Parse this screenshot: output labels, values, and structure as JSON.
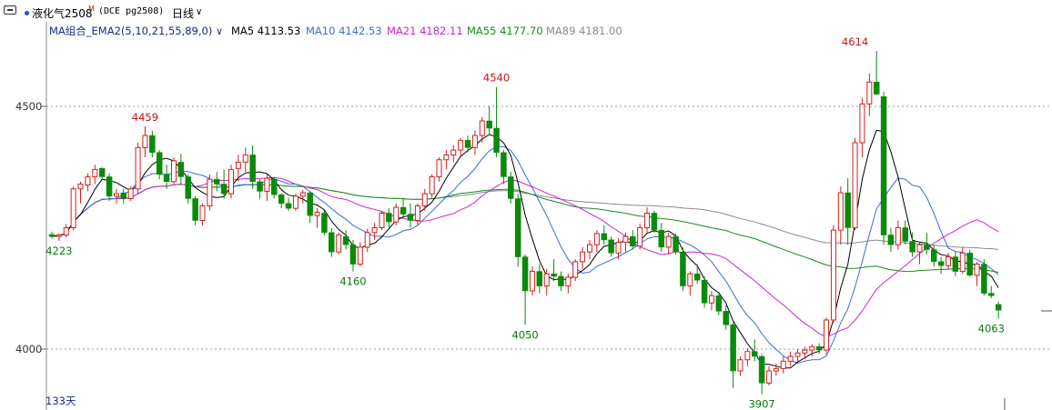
{
  "toolbar": {
    "symbol_name": "液化气2508",
    "superscript": "M",
    "code": "(DCE pg2508)",
    "period": "日线"
  },
  "legend": {
    "group": "MA组合_EMA2(5,10,21,55,89,0)",
    "items": [
      {
        "label": "MA5 4113.53",
        "color": "#000000"
      },
      {
        "label": "MA10 4142.53",
        "color": "#3a6ad8"
      },
      {
        "label": "MA21 4182.11",
        "color": "#d020d0"
      },
      {
        "label": "MA55 4177.70",
        "color": "#1a8a1a"
      },
      {
        "label": "MA89 4181.00",
        "color": "#8a8a8a"
      }
    ]
  },
  "days_label": "133天",
  "chart_data": {
    "type": "candlestick",
    "y_ticks": [
      4000,
      4500
    ],
    "up_color": "#d02020",
    "down_color": "#0a8a0a",
    "annotations": [
      {
        "value": 4223,
        "label": "4223",
        "kind": "low",
        "index": 1
      },
      {
        "value": 4459,
        "label": "4459",
        "kind": "high",
        "index": 13
      },
      {
        "value": 4160,
        "label": "4160",
        "kind": "low",
        "index": 42
      },
      {
        "value": 4540,
        "label": "4540",
        "kind": "high",
        "index": 62
      },
      {
        "value": 4050,
        "label": "4050",
        "kind": "low",
        "index": 66
      },
      {
        "value": 3907,
        "label": "3907",
        "kind": "low",
        "index": 99
      },
      {
        "value": 4614,
        "label": "4614",
        "kind": "high",
        "index": 112
      },
      {
        "value": 4063,
        "label": "4063",
        "kind": "low",
        "index": 131
      }
    ],
    "candles": [
      [
        4236,
        4242,
        4228,
        4232
      ],
      [
        4232,
        4238,
        4223,
        4235
      ],
      [
        4235,
        4258,
        4230,
        4250
      ],
      [
        4250,
        4335,
        4245,
        4330
      ],
      [
        4330,
        4345,
        4300,
        4340
      ],
      [
        4338,
        4362,
        4325,
        4355
      ],
      [
        4355,
        4380,
        4340,
        4370
      ],
      [
        4372,
        4375,
        4350,
        4355
      ],
      [
        4355,
        4362,
        4305,
        4315
      ],
      [
        4315,
        4330,
        4300,
        4320
      ],
      [
        4322,
        4330,
        4300,
        4310
      ],
      [
        4310,
        4335,
        4305,
        4330
      ],
      [
        4330,
        4425,
        4320,
        4415
      ],
      [
        4415,
        4459,
        4395,
        4440
      ],
      [
        4440,
        4450,
        4395,
        4405
      ],
      [
        4405,
        4410,
        4350,
        4360
      ],
      [
        4360,
        4380,
        4330,
        4345
      ],
      [
        4345,
        4395,
        4340,
        4388
      ],
      [
        4385,
        4402,
        4340,
        4355
      ],
      [
        4355,
        4360,
        4300,
        4310
      ],
      [
        4310,
        4315,
        4255,
        4265
      ],
      [
        4265,
        4300,
        4255,
        4295
      ],
      [
        4295,
        4360,
        4285,
        4350
      ],
      [
        4350,
        4365,
        4325,
        4340
      ],
      [
        4340,
        4370,
        4310,
        4320
      ],
      [
        4320,
        4380,
        4310,
        4370
      ],
      [
        4372,
        4400,
        4345,
        4385
      ],
      [
        4385,
        4415,
        4365,
        4400
      ],
      [
        4400,
        4420,
        4330,
        4345
      ],
      [
        4345,
        4350,
        4310,
        4325
      ],
      [
        4325,
        4360,
        4305,
        4352
      ],
      [
        4350,
        4355,
        4310,
        4318
      ],
      [
        4318,
        4320,
        4290,
        4300
      ],
      [
        4300,
        4312,
        4285,
        4290
      ],
      [
        4290,
        4320,
        4285,
        4315
      ],
      [
        4315,
        4328,
        4300,
        4322
      ],
      [
        4322,
        4325,
        4260,
        4275
      ],
      [
        4275,
        4290,
        4250,
        4282
      ],
      [
        4280,
        4285,
        4235,
        4240
      ],
      [
        4240,
        4250,
        4190,
        4200
      ],
      [
        4200,
        4240,
        4195,
        4235
      ],
      [
        4232,
        4245,
        4205,
        4215
      ],
      [
        4215,
        4225,
        4160,
        4175
      ],
      [
        4175,
        4220,
        4170,
        4210
      ],
      [
        4210,
        4248,
        4200,
        4240
      ],
      [
        4240,
        4260,
        4225,
        4250
      ],
      [
        4250,
        4285,
        4245,
        4280
      ],
      [
        4280,
        4290,
        4250,
        4262
      ],
      [
        4262,
        4300,
        4255,
        4292
      ],
      [
        4292,
        4310,
        4270,
        4278
      ],
      [
        4278,
        4300,
        4250,
        4265
      ],
      [
        4265,
        4300,
        4255,
        4295
      ],
      [
        4295,
        4330,
        4285,
        4320
      ],
      [
        4320,
        4360,
        4310,
        4355
      ],
      [
        4355,
        4395,
        4345,
        4390
      ],
      [
        4390,
        4410,
        4370,
        4400
      ],
      [
        4400,
        4420,
        4385,
        4410
      ],
      [
        4410,
        4435,
        4395,
        4430
      ],
      [
        4430,
        4440,
        4405,
        4415
      ],
      [
        4415,
        4450,
        4400,
        4440
      ],
      [
        4440,
        4478,
        4425,
        4470
      ],
      [
        4470,
        4500,
        4440,
        4455
      ],
      [
        4455,
        4540,
        4395,
        4405
      ],
      [
        4405,
        4410,
        4340,
        4355
      ],
      [
        4355,
        4365,
        4300,
        4310
      ],
      [
        4310,
        4320,
        4170,
        4190
      ],
      [
        4190,
        4195,
        4050,
        4120
      ],
      [
        4120,
        4170,
        4110,
        4160
      ],
      [
        4160,
        4175,
        4115,
        4130
      ],
      [
        4130,
        4165,
        4110,
        4155
      ],
      [
        4155,
        4185,
        4140,
        4150
      ],
      [
        4150,
        4160,
        4120,
        4130
      ],
      [
        4130,
        4155,
        4115,
        4148
      ],
      [
        4148,
        4185,
        4140,
        4180
      ],
      [
        4180,
        4210,
        4165,
        4200
      ],
      [
        4200,
        4225,
        4185,
        4215
      ],
      [
        4215,
        4245,
        4200,
        4238
      ],
      [
        4238,
        4255,
        4215,
        4225
      ],
      [
        4225,
        4232,
        4190,
        4198
      ],
      [
        4198,
        4228,
        4185,
        4220
      ],
      [
        4220,
        4240,
        4200,
        4232
      ],
      [
        4232,
        4245,
        4205,
        4212
      ],
      [
        4212,
        4258,
        4205,
        4250
      ],
      [
        4250,
        4292,
        4240,
        4280
      ],
      [
        4280,
        4285,
        4240,
        4245
      ],
      [
        4245,
        4260,
        4200,
        4210
      ],
      [
        4210,
        4240,
        4195,
        4232
      ],
      [
        4232,
        4238,
        4195,
        4200
      ],
      [
        4200,
        4210,
        4120,
        4130
      ],
      [
        4130,
        4160,
        4110,
        4155
      ],
      [
        4155,
        4175,
        4135,
        4142
      ],
      [
        4142,
        4150,
        4085,
        4095
      ],
      [
        4095,
        4120,
        4080,
        4110
      ],
      [
        4110,
        4118,
        4070,
        4078
      ],
      [
        4078,
        4090,
        4040,
        4050
      ],
      [
        4050,
        4055,
        3920,
        3955
      ],
      [
        3955,
        3985,
        3945,
        3978
      ],
      [
        3978,
        4002,
        3965,
        3995
      ],
      [
        3995,
        4020,
        3975,
        3985
      ],
      [
        3985,
        3990,
        3907,
        3930
      ],
      [
        3930,
        3965,
        3925,
        3955
      ],
      [
        3955,
        3970,
        3945,
        3960
      ],
      [
        3960,
        3985,
        3950,
        3975
      ],
      [
        3975,
        3995,
        3965,
        3985
      ],
      [
        3985,
        4000,
        3970,
        3992
      ],
      [
        3992,
        4005,
        3980,
        3998
      ],
      [
        3998,
        4010,
        3985,
        4005
      ],
      [
        4005,
        4012,
        3990,
        3998
      ],
      [
        3998,
        4065,
        3990,
        4060
      ],
      [
        4060,
        4255,
        4055,
        4245
      ],
      [
        4245,
        4335,
        4215,
        4322
      ],
      [
        4322,
        4352,
        4215,
        4250
      ],
      [
        4250,
        4435,
        4245,
        4425
      ],
      [
        4425,
        4518,
        4395,
        4505
      ],
      [
        4505,
        4568,
        4480,
        4550
      ],
      [
        4550,
        4614,
        4525,
        4525
      ],
      [
        4520,
        4530,
        4215,
        4235
      ],
      [
        4235,
        4250,
        4200,
        4215
      ],
      [
        4215,
        4265,
        4205,
        4250
      ],
      [
        4250,
        4265,
        4215,
        4222
      ],
      [
        4222,
        4240,
        4190,
        4200
      ],
      [
        4200,
        4222,
        4175,
        4215
      ],
      [
        4215,
        4240,
        4195,
        4205
      ],
      [
        4205,
        4215,
        4170,
        4180
      ],
      [
        4180,
        4190,
        4155,
        4172
      ],
      [
        4172,
        4198,
        4165,
        4190
      ],
      [
        4190,
        4202,
        4150,
        4160
      ],
      [
        4160,
        4210,
        4155,
        4198
      ],
      [
        4198,
        4205,
        4150,
        4152
      ],
      [
        4152,
        4180,
        4130,
        4175
      ],
      [
        4175,
        4185,
        4110,
        4115
      ],
      [
        4115,
        4130,
        4105,
        4110
      ],
      [
        4092,
        4098,
        4063,
        4080
      ]
    ]
  }
}
